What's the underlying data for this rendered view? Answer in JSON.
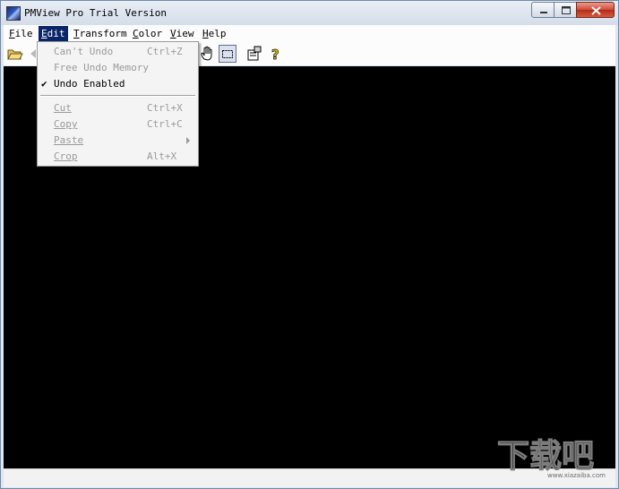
{
  "window": {
    "title": "PMView Pro Trial Version"
  },
  "menubar": {
    "items": [
      {
        "label": "File",
        "mnemonic": "F",
        "rest": "ile"
      },
      {
        "label": "Edit",
        "mnemonic": "E",
        "rest": "dit"
      },
      {
        "label": "Transform",
        "mnemonic": "T",
        "rest": "ransform"
      },
      {
        "label": "Color",
        "mnemonic": "C",
        "rest": "olor"
      },
      {
        "label": "View",
        "mnemonic": "V",
        "rest": "iew"
      },
      {
        "label": "Help",
        "mnemonic": "H",
        "rest": "elp"
      }
    ]
  },
  "edit_menu": {
    "items": [
      {
        "label": "Can't Undo",
        "shortcut": "Ctrl+Z",
        "enabled": false
      },
      {
        "label": "Free Undo Memory",
        "shortcut": "",
        "enabled": false
      },
      {
        "label": "Undo Enabled",
        "shortcut": "",
        "enabled": true,
        "checked": true
      },
      {
        "label": "Cut",
        "shortcut": "Ctrl+X",
        "enabled": false
      },
      {
        "label": "Copy",
        "shortcut": "Ctrl+C",
        "enabled": false
      },
      {
        "label": "Paste",
        "shortcut": "",
        "enabled": false,
        "submenu": true
      },
      {
        "label": "Crop",
        "shortcut": "Alt+X",
        "enabled": false
      }
    ]
  },
  "toolbar": {
    "icons": [
      "open-folder-icon",
      "back-icon",
      "hand-icon",
      "select-rect-icon",
      "properties-icon",
      "help-icon"
    ]
  },
  "watermark": {
    "text": "下载吧",
    "site": "www.xiazaiba.com"
  },
  "colors": {
    "menu_highlight": "#0a246a",
    "canvas": "#000000",
    "disabled_text": "#9a9a9a"
  }
}
